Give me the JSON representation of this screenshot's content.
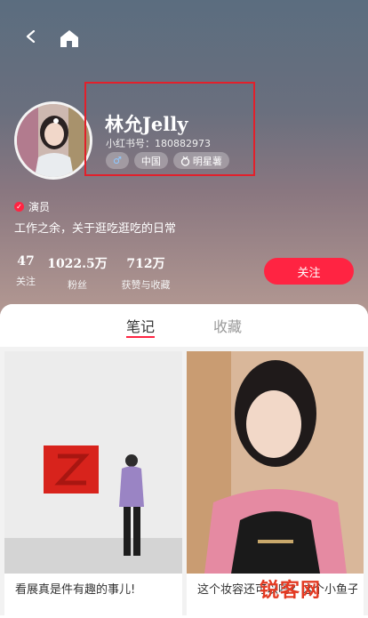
{
  "profile": {
    "name": "林允Jelly",
    "red_id": "小红书号：180882973",
    "tags": [
      {
        "icon": "male-icon",
        "label": "♂"
      },
      {
        "icon": "",
        "label": "中国"
      },
      {
        "icon": "medal-icon",
        "label": "明星薯"
      }
    ],
    "verification": "演员",
    "bio": "工作之余，关于逛吃逛吃的日常"
  },
  "stats": [
    {
      "value": "47",
      "label": "关注"
    },
    {
      "value": "1022.5万",
      "label": "粉丝"
    },
    {
      "value": "712万",
      "label": "获赞与收藏"
    }
  ],
  "follow_button": "关注",
  "tabs": [
    {
      "label": "笔记",
      "active": true
    },
    {
      "label": "收藏",
      "active": false
    }
  ],
  "notes": [
    {
      "title": "看展真是件有趣的事儿!"
    },
    {
      "title": "这个妆容还可以吗？这个小鱼子又像只蘑菇"
    }
  ],
  "watermark": "锐客网",
  "colors": {
    "accent": "#ff2442",
    "highlight_box": "#e2202b"
  }
}
